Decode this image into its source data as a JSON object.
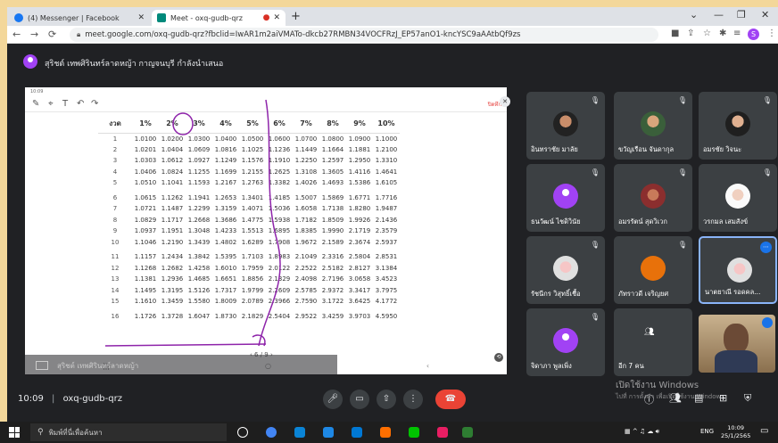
{
  "tabs": [
    {
      "title": "(4) Messenger | Facebook",
      "icon": "messenger-icon",
      "color": "#1877f2"
    },
    {
      "title": "Meet - oxq-gudb-qrz",
      "icon": "meet-icon",
      "color": "#00897b",
      "recording": true
    }
  ],
  "address": {
    "url": "meet.google.com/oxq-gudb-qrz?fbclid=IwAR1m2aiVMATo-dkcb27RMBN34VOCFRzJ_EP57anO1-kncYSC9aAAtbQf9zs"
  },
  "presenter": {
    "text": "สุริชต์ เทพศิรินทร์ลาดหญ้า กาญจนบุรี กำลังนำเสนอ"
  },
  "document": {
    "status": "10:09",
    "close_label": "ปิดทึก",
    "headers": [
      "งวด",
      "1%",
      "2%",
      "3%",
      "4%",
      "5%",
      "6%",
      "7%",
      "8%",
      "9%",
      "10%"
    ],
    "rows": [
      [
        "1",
        "1.0100",
        "1.0200",
        "1.0300",
        "1.0400",
        "1.0500",
        "1.0600",
        "1.0700",
        "1.0800",
        "1.0900",
        "1.1000"
      ],
      [
        "2",
        "1.0201",
        "1.0404",
        "1.0609",
        "1.0816",
        "1.1025",
        "1.1236",
        "1.1449",
        "1.1664",
        "1.1881",
        "1.2100"
      ],
      [
        "3",
        "1.0303",
        "1.0612",
        "1.0927",
        "1.1249",
        "1.1576",
        "1.1910",
        "1.2250",
        "1.2597",
        "1.2950",
        "1.3310"
      ],
      [
        "4",
        "1.0406",
        "1.0824",
        "1.1255",
        "1.1699",
        "1.2155",
        "1.2625",
        "1.3108",
        "1.3605",
        "1.4116",
        "1.4641"
      ],
      [
        "5",
        "1.0510",
        "1.1041",
        "1.1593",
        "1.2167",
        "1.2763",
        "1.3382",
        "1.4026",
        "1.4693",
        "1.5386",
        "1.6105"
      ],
      [
        "6",
        "1.0615",
        "1.1262",
        "1.1941",
        "1.2653",
        "1.3401",
        "1.4185",
        "1.5007",
        "1.5869",
        "1.6771",
        "1.7716"
      ],
      [
        "7",
        "1.0721",
        "1.1487",
        "1.2299",
        "1.3159",
        "1.4071",
        "1.5036",
        "1.6058",
        "1.7138",
        "1.8280",
        "1.9487"
      ],
      [
        "8",
        "1.0829",
        "1.1717",
        "1.2668",
        "1.3686",
        "1.4775",
        "1.5938",
        "1.7182",
        "1.8509",
        "1.9926",
        "2.1436"
      ],
      [
        "9",
        "1.0937",
        "1.1951",
        "1.3048",
        "1.4233",
        "1.5513",
        "1.6895",
        "1.8385",
        "1.9990",
        "2.1719",
        "2.3579"
      ],
      [
        "10",
        "1.1046",
        "1.2190",
        "1.3439",
        "1.4802",
        "1.6289",
        "1.7908",
        "1.9672",
        "2.1589",
        "2.3674",
        "2.5937"
      ],
      [
        "11",
        "1.1157",
        "1.2434",
        "1.3842",
        "1.5395",
        "1.7103",
        "1.8983",
        "2.1049",
        "2.3316",
        "2.5804",
        "2.8531"
      ],
      [
        "12",
        "1.1268",
        "1.2682",
        "1.4258",
        "1.6010",
        "1.7959",
        "2.0122",
        "2.2522",
        "2.5182",
        "2.8127",
        "3.1384"
      ],
      [
        "13",
        "1.1381",
        "1.2936",
        "1.4685",
        "1.6651",
        "1.8856",
        "2.1329",
        "2.4098",
        "2.7196",
        "3.0658",
        "3.4523"
      ],
      [
        "14",
        "1.1495",
        "1.3195",
        "1.5126",
        "1.7317",
        "1.9799",
        "2.2609",
        "2.5785",
        "2.9372",
        "3.3417",
        "3.7975"
      ],
      [
        "15",
        "1.1610",
        "1.3459",
        "1.5580",
        "1.8009",
        "2.0789",
        "2.3966",
        "2.7590",
        "3.1722",
        "3.6425",
        "4.1772"
      ],
      [
        "16",
        "1.1726",
        "1.3728",
        "1.6047",
        "1.8730",
        "2.1829",
        "2.5404",
        "2.9522",
        "3.4259",
        "3.9703",
        "4.5950"
      ]
    ],
    "page_indicator": "6 / 9",
    "fade_text": "สุริชต์ เทพศิรินทร์ลาดหญ้า"
  },
  "participants": [
    {
      "name": "อินทราชัย มาลัย",
      "avatar": "photo"
    },
    {
      "name": "ขวัญเรือน จันดากุล",
      "avatar": "photo2"
    },
    {
      "name": "อมรชัย วิจนะ",
      "avatar": "photo3"
    },
    {
      "name": "ธนวัฒน์ ไชดิวินัย",
      "avatar": "purple"
    },
    {
      "name": "อมรรัตน์ สุดวิเวก",
      "avatar": "photo4"
    },
    {
      "name": "วรกมล เสมสังข์",
      "avatar": "photo5"
    },
    {
      "name": "รัชนีกร วิสุทธิ์เชื้อ",
      "avatar": "photo6"
    },
    {
      "name": "ภัทราวดี เจริญยศ",
      "avatar": "orange"
    },
    {
      "name": "นาตยาณี รอดคล...",
      "avatar": "photo6"
    },
    {
      "name": "จิดาภา พูลเพิ่ง",
      "avatar": "purple"
    },
    {
      "name": "อีก 7 คน",
      "avatar": "group"
    }
  ],
  "controls": {
    "time": "10:09",
    "meeting_code": "oxq-gudb-qrz"
  },
  "watermark": {
    "line1": "เปิดใช้งาน Windows",
    "line2": "ไปที่ การตั้งค่า เพื่อเปิดใช้งาน Windows"
  },
  "taskbar": {
    "search_placeholder": "พิมพ์ที่นี่เพื่อค้นหา",
    "lang": "ENG",
    "time": "10:09",
    "date": "25/1/2565"
  }
}
